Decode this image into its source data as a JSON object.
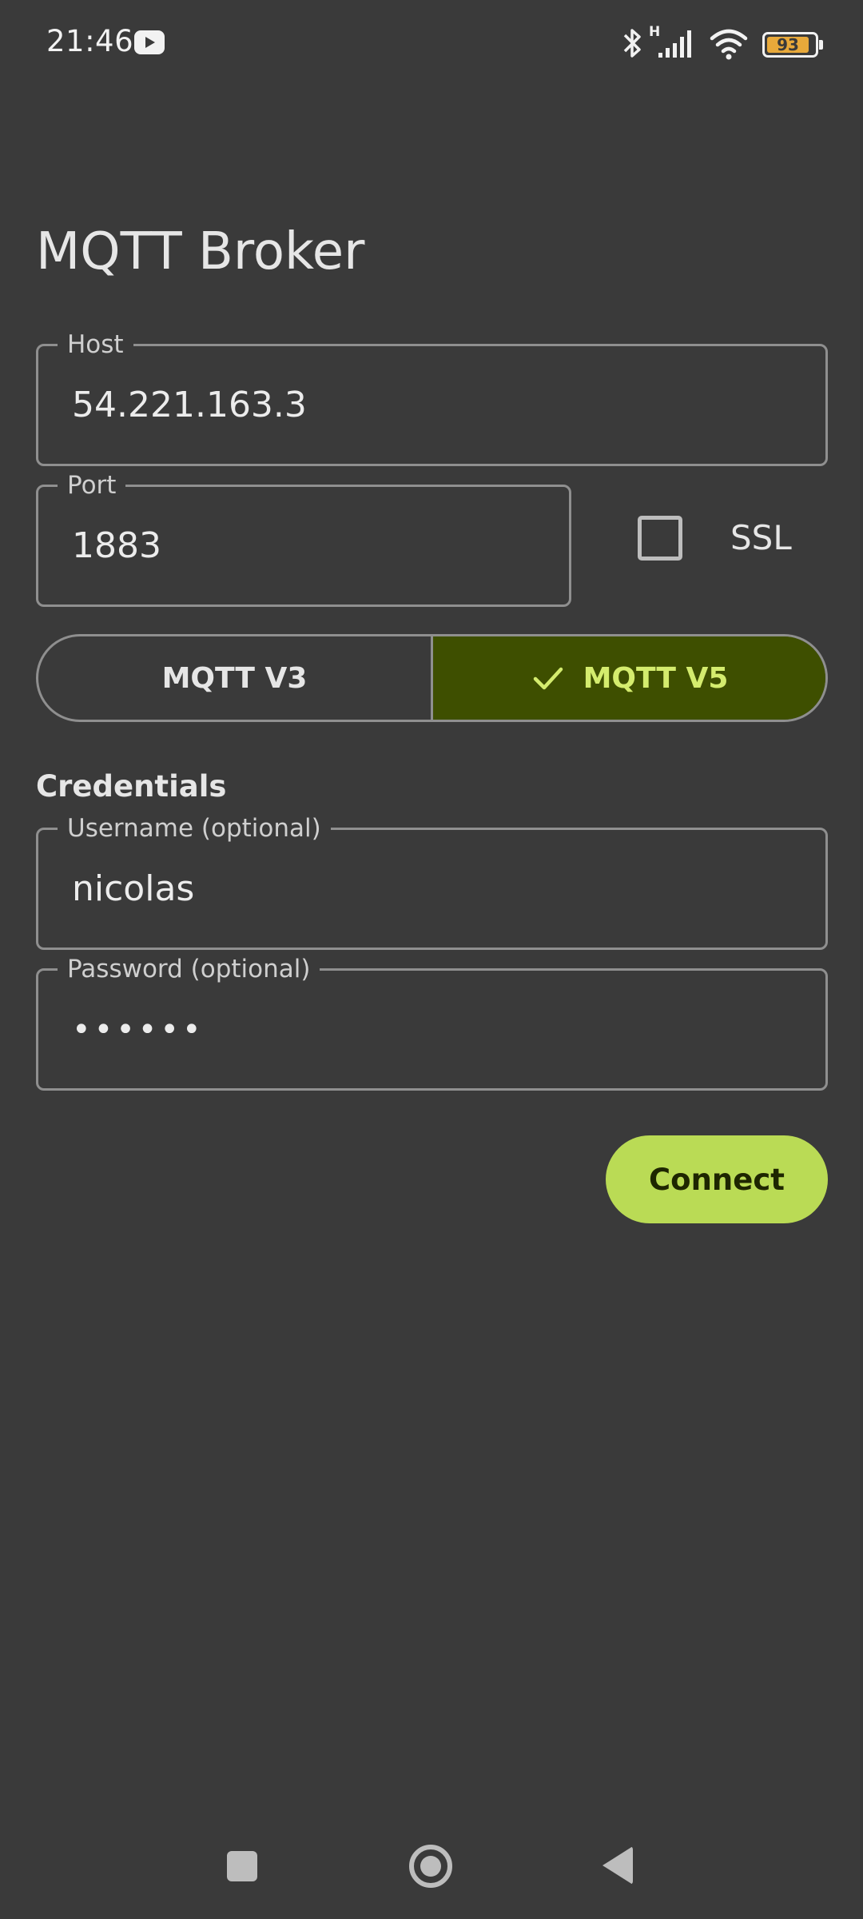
{
  "status_bar": {
    "time": "21:46",
    "network_label": "H",
    "battery_level": "93",
    "icons": [
      "youtube-icon",
      "bluetooth-icon",
      "signal-icon",
      "wifi-icon",
      "battery-icon"
    ]
  },
  "page": {
    "title": "MQTT Broker"
  },
  "host": {
    "label": "Host",
    "value": "54.221.163.3"
  },
  "port": {
    "label": "Port",
    "value": "1883"
  },
  "ssl": {
    "label": "SSL",
    "checked": false
  },
  "protocol": {
    "options": [
      "MQTT V3",
      "MQTT V5"
    ],
    "selected": "MQTT V5",
    "v3_label": "MQTT V3",
    "v5_label": "MQTT V5"
  },
  "credentials": {
    "title": "Credentials",
    "username_label": "Username (optional)",
    "username_value": "nicolas",
    "password_label": "Password (optional)",
    "password_value": "••••••"
  },
  "actions": {
    "connect_label": "Connect"
  },
  "colors": {
    "background": "#3a3a3a",
    "accent": "#badb55",
    "selected_segment": "#3e4f00",
    "selected_text": "#d4ec6e",
    "battery": "#e8a93a"
  }
}
